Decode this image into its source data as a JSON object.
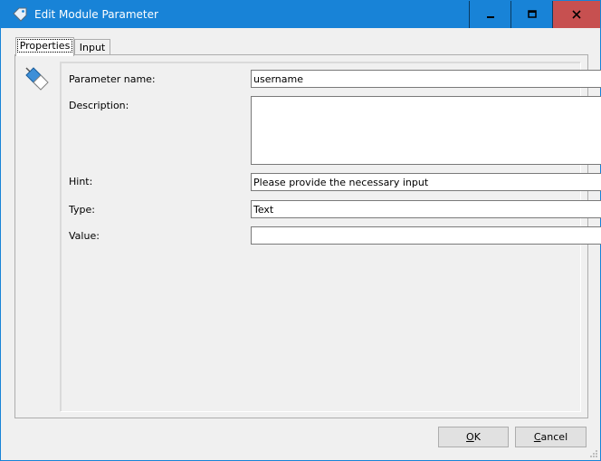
{
  "window": {
    "title": "Edit Module Parameter",
    "controls": {
      "minimize": "minimize",
      "maximize": "maximize",
      "close": "close"
    }
  },
  "tabs": [
    {
      "label": "Properties",
      "active": true
    },
    {
      "label": "Input",
      "active": false
    }
  ],
  "form": {
    "parameter_name": {
      "label": "Parameter name:",
      "value": "username"
    },
    "description": {
      "label": "Description:",
      "value": ""
    },
    "hint": {
      "label": "Hint:",
      "value": "Please provide the necessary input"
    },
    "type": {
      "label": "Type:",
      "value": "Text"
    },
    "value": {
      "label": "Value:",
      "value": ""
    }
  },
  "buttons": {
    "ok": {
      "label_first": "O",
      "label_rest": "K"
    },
    "cancel": {
      "label_first": "C",
      "label_rest": "ancel"
    }
  },
  "colors": {
    "titlebar": "#1883d7",
    "close_button": "#c75050",
    "panel": "#f0f0f0"
  },
  "icons": {
    "title": "tag-icon",
    "parameter": "tag-icon"
  }
}
